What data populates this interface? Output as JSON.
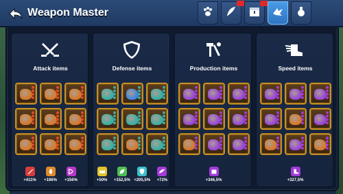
{
  "header": {
    "title": "Weapon Master",
    "tabs": [
      {
        "icon": "paw-icon",
        "active": false,
        "notification": false
      },
      {
        "icon": "feather-icon",
        "active": false,
        "notification": true
      },
      {
        "icon": "treasure-chest-icon",
        "active": false,
        "notification": true
      },
      {
        "icon": "dragon-icon",
        "active": true,
        "notification": false
      },
      {
        "icon": "potion-icon",
        "active": false,
        "notification": false
      }
    ]
  },
  "colors": {
    "accent_active_tab": "#3f8ad6",
    "item_border": "#c79025",
    "attack_red": "#d83b3b",
    "defense_green": "#4fbf52",
    "production_purple": "#a33bd8",
    "speed_blue": "#4fa3e0"
  },
  "columns": [
    {
      "key": "attack",
      "title": "Attack items",
      "icon": "crossed-swords-icon",
      "items": [
        "orange",
        "orange",
        "orange",
        "orange",
        "orange",
        "orange",
        "orange",
        "orange",
        "orange"
      ],
      "pip_color": "#e44a2a",
      "bonuses": [
        {
          "icon": "sword-icon",
          "color": "#d83b3b",
          "value": "+411%"
        },
        {
          "icon": "flame-icon",
          "color": "#e0892b",
          "value": "+196%"
        },
        {
          "icon": "bow-icon",
          "color": "#b837c9",
          "value": "+156%"
        }
      ]
    },
    {
      "key": "defense",
      "title": "Defense items",
      "icon": "shield-icon",
      "items": [
        "teal",
        "blue",
        "teal",
        "teal",
        "teal",
        "teal",
        "teal",
        "orange",
        "teal"
      ],
      "pip_color": "#3ea8a0",
      "bonuses": [
        {
          "icon": "crown-icon",
          "color": "#e2c42b",
          "value": "+50%"
        },
        {
          "icon": "leaf-icon",
          "color": "#4fbf52",
          "value": "+152,5%"
        },
        {
          "icon": "shield-small-icon",
          "color": "#3ec0c9",
          "value": "+205,5%"
        },
        {
          "icon": "wing-icon",
          "color": "#a33bd8",
          "value": "+72%"
        }
      ]
    },
    {
      "key": "production",
      "title": "Production items",
      "icon": "hammer-tools-icon",
      "items": [
        "purple",
        "purple",
        "purple",
        "purple",
        "purple",
        "purple",
        "orange",
        "purple",
        "purple"
      ],
      "pip_color": "#a33bd8",
      "bonuses": [
        {
          "icon": "box-icon",
          "color": "#a33bd8",
          "value": "+346,5%"
        }
      ]
    },
    {
      "key": "speed",
      "title": "Speed items",
      "icon": "winged-boot-icon",
      "items": [
        "purple",
        "purple",
        "purple",
        "purple",
        "orange",
        "purple",
        "orange",
        "purple",
        "orange"
      ],
      "pip_color": "#a33bd8",
      "bonuses": [
        {
          "icon": "boot-icon",
          "color": "#a33bd8",
          "value": "+327,5%"
        }
      ]
    }
  ]
}
